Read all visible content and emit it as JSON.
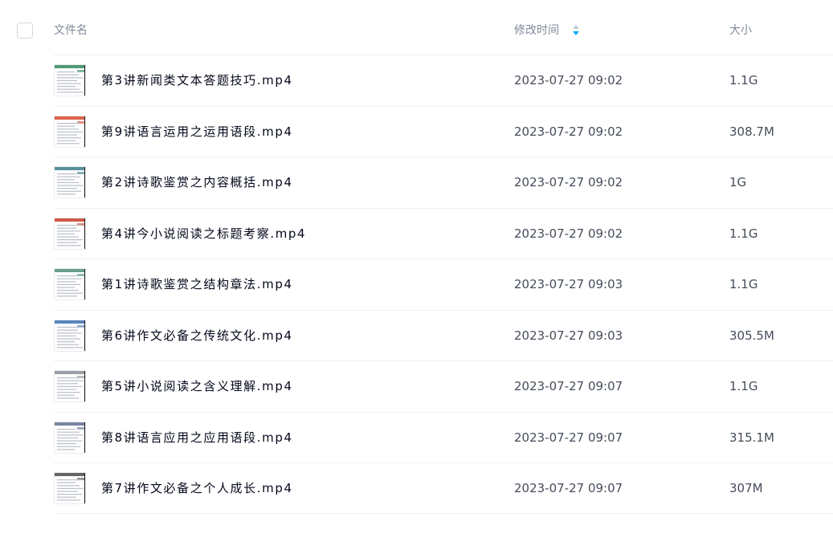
{
  "header": {
    "name_label": "文件名",
    "time_label": "修改时间",
    "size_label": "大小",
    "sort_icon": "sort-icon",
    "accent_color": "#06a7ff"
  },
  "files": [
    {
      "name": "第3讲新闻类文本答题技巧.mp4",
      "time": "2023-07-27 09:02",
      "size": "1.1G"
    },
    {
      "name": "第9讲语言运用之运用语段.mp4",
      "time": "2023-07-27 09:02",
      "size": "308.7M"
    },
    {
      "name": "第2讲诗歌鉴赏之内容概括.mp4",
      "time": "2023-07-27 09:02",
      "size": "1G"
    },
    {
      "name": "第4讲今小说阅读之标题考察.mp4",
      "time": "2023-07-27 09:02",
      "size": "1.1G"
    },
    {
      "name": "第1讲诗歌鉴赏之结构章法.mp4",
      "time": "2023-07-27 09:03",
      "size": "1.1G"
    },
    {
      "name": "第6讲作文必备之传统文化.mp4",
      "time": "2023-07-27 09:03",
      "size": "305.5M"
    },
    {
      "name": "第5讲小说阅读之含义理解.mp4",
      "time": "2023-07-27 09:07",
      "size": "1.1G"
    },
    {
      "name": "第8讲语言应用之应用语段.mp4",
      "time": "2023-07-27 09:07",
      "size": "315.1M"
    },
    {
      "name": "第7讲作文必备之个人成长.mp4",
      "time": "2023-07-27 09:07",
      "size": "307M"
    }
  ]
}
